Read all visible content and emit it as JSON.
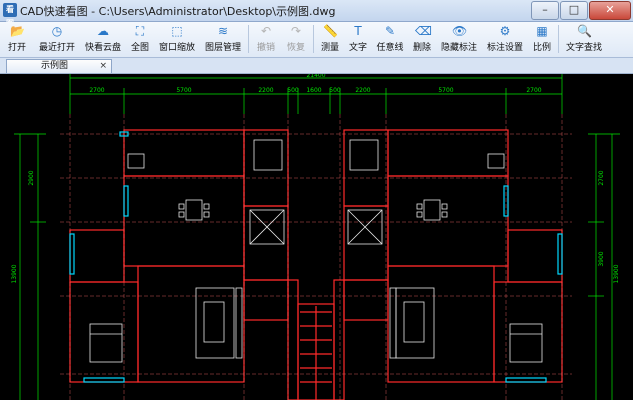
{
  "window": {
    "app_icon_text": "看图",
    "title": "CAD快速看图 - C:\\Users\\Administrator\\Desktop\\示例图.dwg",
    "minimize": "–",
    "maximize": "□",
    "close": "✕"
  },
  "toolbar": {
    "items": [
      {
        "label": "打开",
        "icon": "folder-icon",
        "glyph": "📂",
        "enabled": true
      },
      {
        "label": "最近打开",
        "icon": "clock-icon",
        "glyph": "◷",
        "enabled": true
      },
      {
        "label": "快看云盘",
        "icon": "cloud-icon",
        "glyph": "☁",
        "enabled": true
      },
      {
        "label": "全图",
        "icon": "fit-icon",
        "glyph": "⛶",
        "enabled": true
      },
      {
        "label": "窗口缩放",
        "icon": "window-zoom-icon",
        "glyph": "⬚",
        "enabled": true
      },
      {
        "label": "图层管理",
        "icon": "layers-icon",
        "glyph": "≋",
        "enabled": true
      },
      {
        "label": "撤销",
        "icon": "undo-icon",
        "glyph": "↶",
        "enabled": false
      },
      {
        "label": "恢复",
        "icon": "redo-icon",
        "glyph": "↷",
        "enabled": false
      },
      {
        "label": "测量",
        "icon": "ruler-icon",
        "glyph": "📏",
        "enabled": true
      },
      {
        "label": "文字",
        "icon": "text-icon",
        "glyph": "T",
        "enabled": true
      },
      {
        "label": "任意线",
        "icon": "pen-icon",
        "glyph": "✎",
        "enabled": true
      },
      {
        "label": "删除",
        "icon": "eraser-icon",
        "glyph": "⌫",
        "enabled": true
      },
      {
        "label": "隐藏标注",
        "icon": "eye-icon",
        "glyph": "👁",
        "enabled": true
      },
      {
        "label": "标注设置",
        "icon": "settings-icon",
        "glyph": "⚙",
        "enabled": true
      },
      {
        "label": "比例",
        "icon": "scale-icon",
        "glyph": "▦",
        "enabled": true
      },
      {
        "label": "文字查找",
        "icon": "find-icon",
        "glyph": "🔍",
        "enabled": true
      }
    ]
  },
  "tabs": {
    "active_label": "示例图",
    "close": "×"
  },
  "drawing": {
    "total_dimension": "21400",
    "top_dimensions": [
      "2700",
      "5700",
      "2200",
      "500",
      "1600",
      "500",
      "2200",
      "5700",
      "2700"
    ],
    "left_dimensions": [
      "2900",
      "13900"
    ],
    "right_dimensions": [
      "2700",
      "3900",
      "13900"
    ],
    "colors": {
      "background": "#000000",
      "walls": "#ff2a2a",
      "dimensions": "#00e600",
      "furniture": "#e8e8e8",
      "windows": "#00d8ff",
      "grid": "#ff6a6a"
    }
  }
}
